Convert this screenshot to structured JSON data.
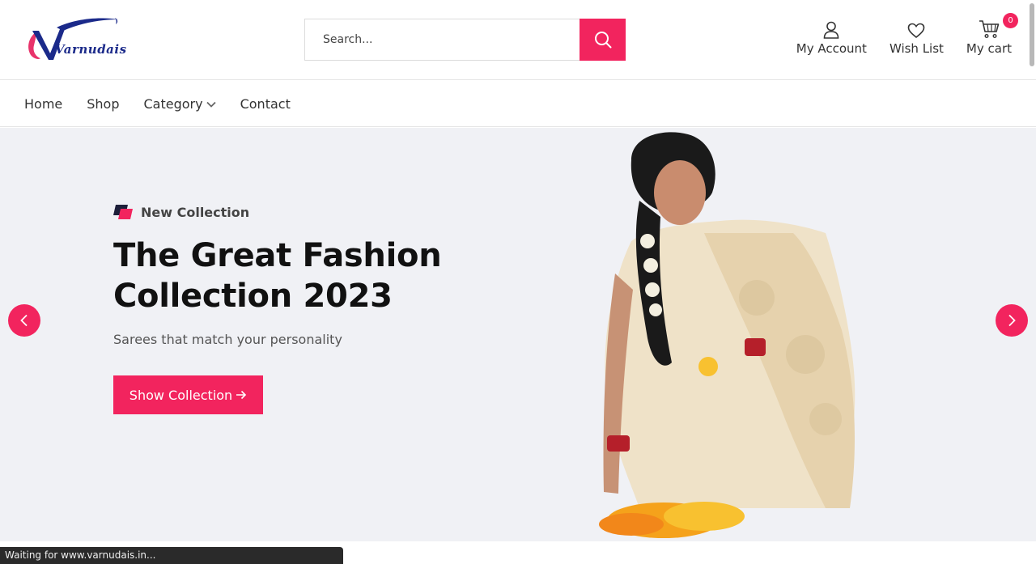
{
  "brand": {
    "logo_text": "Varnudais",
    "accent": "#f2245e",
    "logo_blue": "#1b2a8a"
  },
  "search": {
    "placeholder": "Search...",
    "icon": "search-icon"
  },
  "header_actions": [
    {
      "label": "My Account",
      "icon": "user-icon"
    },
    {
      "label": "Wish List",
      "icon": "heart-icon"
    },
    {
      "label": "My cart",
      "icon": "cart-icon",
      "badge": "0"
    }
  ],
  "nav": {
    "items": [
      {
        "label": "Home"
      },
      {
        "label": "Shop"
      },
      {
        "label": "Category",
        "icon": "chevron-down-icon"
      },
      {
        "label": "Contact"
      }
    ]
  },
  "hero": {
    "tag": "New Collection",
    "title": "The Great Fashion Collection 2023",
    "subtitle": "Sarees that match your personality",
    "button_label": "Show Collection",
    "button_icon": "arrow-right-icon",
    "prev_icon": "chevron-left-icon",
    "next_icon": "chevron-right-icon",
    "background": "#f0f1f5"
  },
  "status_bar": {
    "text": "Waiting for www.varnudais.in..."
  }
}
